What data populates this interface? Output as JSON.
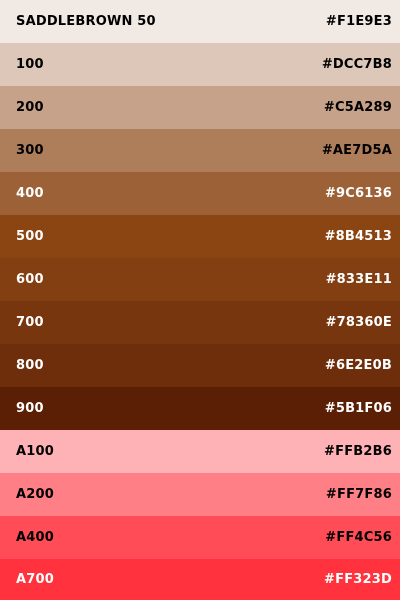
{
  "palette": {
    "swatches": [
      {
        "label": "SADDLEBROWN 50",
        "hex": "#F1E9E3",
        "bg": "#F1E9E3",
        "fg": "#000000"
      },
      {
        "label": "100",
        "hex": "#DCC7B8",
        "bg": "#DCC7B8",
        "fg": "#000000"
      },
      {
        "label": "200",
        "hex": "#C5A289",
        "bg": "#C5A289",
        "fg": "#000000"
      },
      {
        "label": "300",
        "hex": "#AE7D5A",
        "bg": "#AE7D5A",
        "fg": "#000000"
      },
      {
        "label": "400",
        "hex": "#9C6136",
        "bg": "#9C6136",
        "fg": "#FFFFFF"
      },
      {
        "label": "500",
        "hex": "#8B4513",
        "bg": "#8B4513",
        "fg": "#FFFFFF"
      },
      {
        "label": "600",
        "hex": "#833E11",
        "bg": "#833E11",
        "fg": "#FFFFFF"
      },
      {
        "label": "700",
        "hex": "#78360E",
        "bg": "#78360E",
        "fg": "#FFFFFF"
      },
      {
        "label": "800",
        "hex": "#6E2E0B",
        "bg": "#6E2E0B",
        "fg": "#FFFFFF"
      },
      {
        "label": "900",
        "hex": "#5B1F06",
        "bg": "#5B1F06",
        "fg": "#FFFFFF"
      },
      {
        "label": "A100",
        "hex": "#FFB2B6",
        "bg": "#FFB2B6",
        "fg": "#000000"
      },
      {
        "label": "A200",
        "hex": "#FF7F86",
        "bg": "#FF7F86",
        "fg": "#000000"
      },
      {
        "label": "A400",
        "hex": "#FF4C56",
        "bg": "#FF4C56",
        "fg": "#000000"
      },
      {
        "label": "A700",
        "hex": "#FF323D",
        "bg": "#FF323D",
        "fg": "#FFFFFF"
      }
    ]
  }
}
